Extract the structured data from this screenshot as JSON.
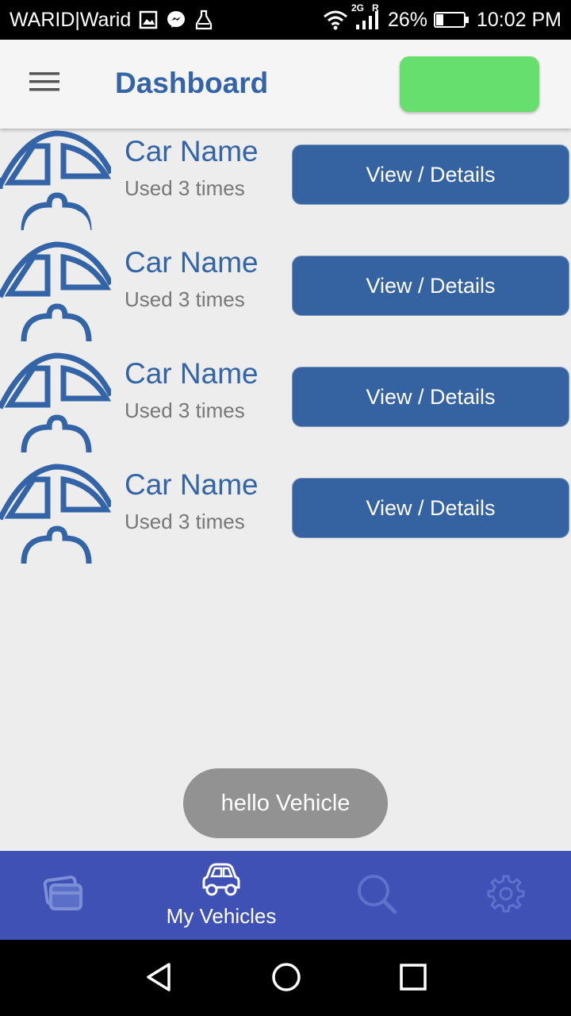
{
  "status_bar": {
    "carrier": "WARID|Warid",
    "network": "2G",
    "roaming": "R",
    "battery_text": "26%",
    "battery_level": 0.26,
    "time": "10:02 PM"
  },
  "app_bar": {
    "title": "Dashboard",
    "menu_icon": "hamburger-menu-icon",
    "action_button_color": "#66df6e"
  },
  "vehicles": [
    {
      "name": "Car Name",
      "usage": "Used 3 times",
      "button": "View / Details"
    },
    {
      "name": "Car Name",
      "usage": "Used 3 times",
      "button": "View / Details"
    },
    {
      "name": "Car Name",
      "usage": "Used 3 times",
      "button": "View / Details"
    },
    {
      "name": "Car Name",
      "usage": "Used 3 times",
      "button": "View / Details"
    }
  ],
  "toast": {
    "text": "hello Vehicle"
  },
  "bottom_nav": {
    "items": [
      {
        "icon": "cards-icon",
        "label": "",
        "active": false
      },
      {
        "icon": "car-icon",
        "label": "My Vehicles",
        "active": true
      },
      {
        "icon": "search-icon",
        "label": "",
        "active": false
      },
      {
        "icon": "gear-icon",
        "label": "",
        "active": false
      }
    ],
    "background": "#3f51b5"
  },
  "system_nav": {
    "back_icon": "back-triangle-icon",
    "home_icon": "home-circle-icon",
    "recents_icon": "recents-square-icon"
  },
  "colors": {
    "primary": "#3464a8",
    "button": "#3562a0",
    "accent_green": "#66df6e"
  }
}
